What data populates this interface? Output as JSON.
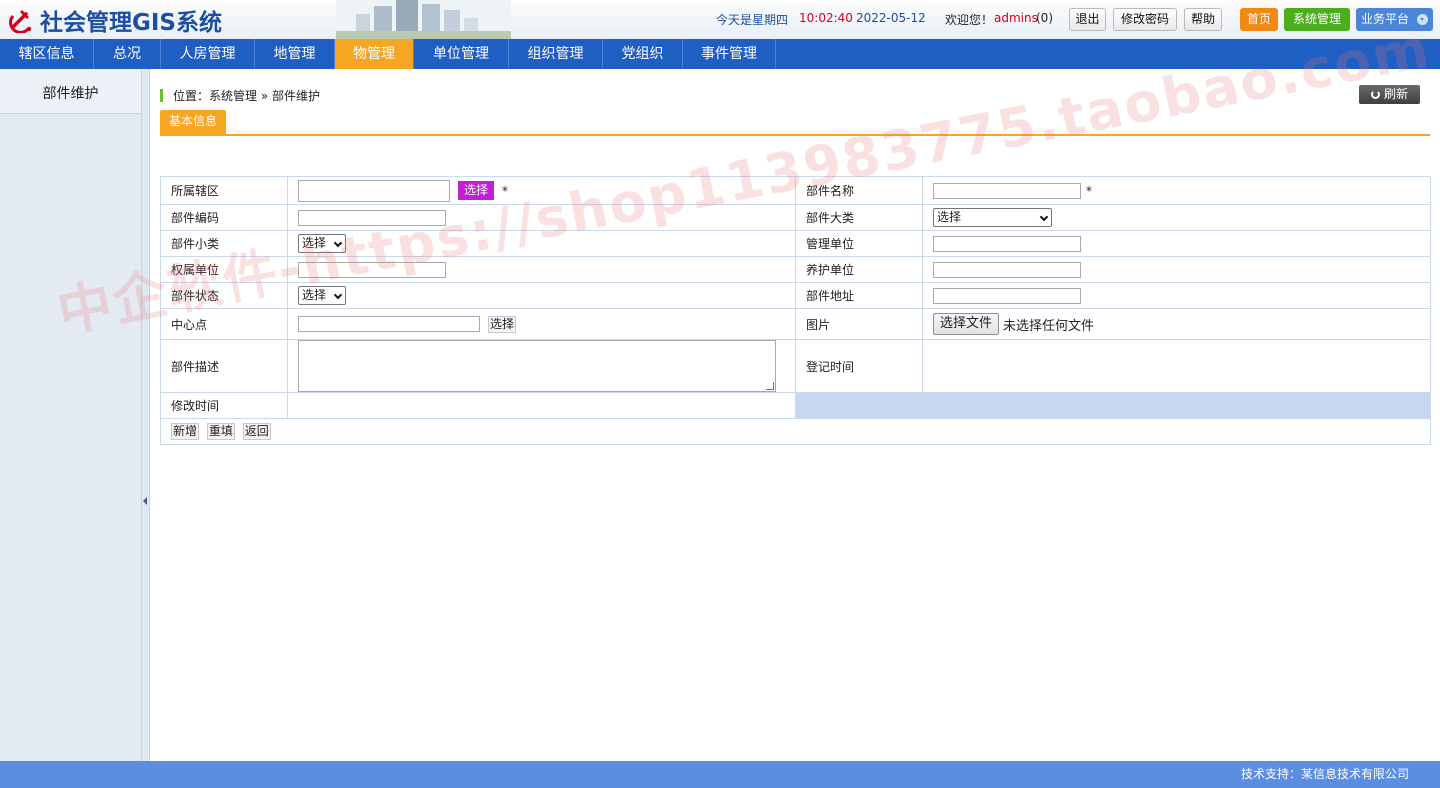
{
  "header": {
    "title": "社会管理GIS系统",
    "weekday": "今天是星期四",
    "time": "10:02:40",
    "date": "2022-05-12",
    "welcome": "欢迎您！",
    "username": "admins",
    "msg_count": "(0)",
    "logout": "退出",
    "change_password": "修改密码",
    "help": "帮助",
    "home": "首页",
    "system_manage": "系统管理",
    "business_platform": "业务平台"
  },
  "nav": {
    "items": [
      "辖区信息",
      "总况",
      "人房管理",
      "地管理",
      "物管理",
      "单位管理",
      "组织管理",
      "党组织",
      "事件管理"
    ],
    "active_index": 4
  },
  "sidebar": {
    "items": [
      "部件维护"
    ]
  },
  "breadcrumb": {
    "text": "位置：系统管理 » 部件维护"
  },
  "toolbar": {
    "refresh": "刷新"
  },
  "tabs": {
    "basic": "基本信息"
  },
  "form": {
    "district_label": "所属辖区",
    "district_pick": "选择",
    "required_mark": "*",
    "part_name_label": "部件名称",
    "part_code_label": "部件编码",
    "part_major_label": "部件大类",
    "part_major_value": "选择",
    "part_minor_label": "部件小类",
    "part_minor_value": "选择",
    "manage_unit_label": "管理单位",
    "owner_unit_label": "权属单位",
    "maintain_unit_label": "养护单位",
    "part_status_label": "部件状态",
    "part_status_value": "选择",
    "part_address_label": "部件地址",
    "center_label": "中心点",
    "center_pick": "选择",
    "image_label": "图片",
    "file_button": "选择文件",
    "file_status": "未选择任何文件",
    "desc_label": "部件描述",
    "register_time_label": "登记时间",
    "modify_time_label": "修改时间",
    "add": "新增",
    "reset": "重填",
    "back": "返回"
  },
  "watermark": "中企软件-https://shop113983775.taobao.com",
  "footer": {
    "support": "技术支持：某信息技术有限公司"
  },
  "colors": {
    "nav_bg": "#1f5ec2",
    "nav_active": "#f5a623",
    "pick_button": "#c21ed6",
    "home_button": "#f08a12",
    "system_button": "#4cae1f",
    "platform_button": "#4a86d8",
    "footer_bg": "#5b8ee0"
  }
}
